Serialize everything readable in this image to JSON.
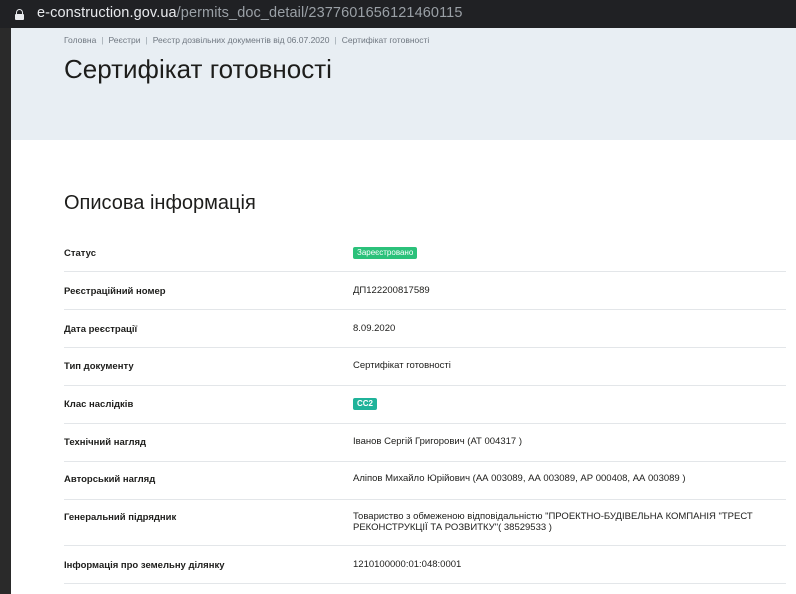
{
  "browser": {
    "url_domain": "e-construction.gov.ua",
    "url_path": "/permits_doc_detail/2377601656121460115"
  },
  "breadcrumb": [
    "Головна",
    "Реєстри",
    "Реєстр дозвільних документів від 06.07.2020",
    "Сертифікат готовності"
  ],
  "page_title": "Сертифікат готовності",
  "section_title": "Описова інформація",
  "colors": {
    "status_badge": "#2bc17a",
    "class_badge": "#1fb39a",
    "header_bg": "#e8eef3"
  },
  "rows": [
    {
      "label": "Статус",
      "value": "Зареєстровано",
      "type": "badge"
    },
    {
      "label": "Реєстраційний номер",
      "value": "ДП122200817589"
    },
    {
      "label": "Дата реєстрації",
      "value": "8.09.2020"
    },
    {
      "label": "Тип документу",
      "value": "Сертифікат готовності"
    },
    {
      "label": "Клас наслідків",
      "value": "СС2",
      "type": "badge"
    },
    {
      "label": "Технічний нагляд",
      "value": "Іванов Сергій Григорович (АТ 004317 )"
    },
    {
      "label": "Авторський нагляд",
      "value": "Аліпов Михайло Юрійович (АА 003089, АА 003089, АР 000408, АА 003089 )"
    },
    {
      "label": "Генеральний підрядник",
      "value": "Товариство з обмеженою відповідальністю \"ПРОЕКТНО-БУДІВЕЛЬНА КОМПАНІЯ \"ТРЕСТ РЕКОНСТРУКЦІЇ ТА РОЗВИТКУ\"( 38529533 )"
    },
    {
      "label": "Інформація про земельну ділянку",
      "value": "1210100000:01:048:0001"
    }
  ]
}
